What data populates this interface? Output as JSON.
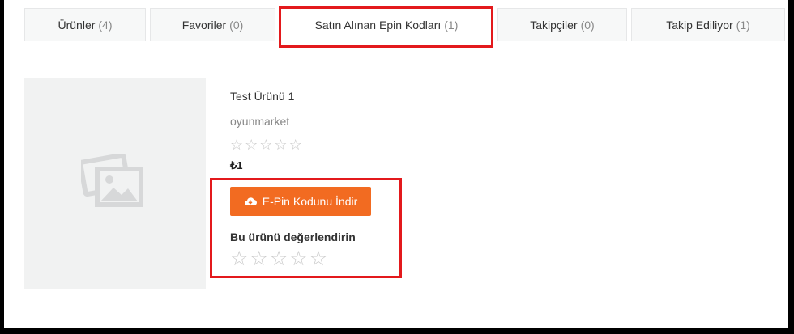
{
  "tabs": [
    {
      "label": "Ürünler",
      "count": "(4)"
    },
    {
      "label": "Favoriler",
      "count": "(0)"
    },
    {
      "label": "Satın Alınan Epin Kodları",
      "count": "(1)"
    },
    {
      "label": "Takipçiler",
      "count": "(0)"
    },
    {
      "label": "Takip Ediliyor",
      "count": "(1)"
    }
  ],
  "product": {
    "title": "Test Ürünü 1",
    "seller": "oyunmarket",
    "rating_stars": 0,
    "price": "₺1",
    "download_label": "E-Pin Kodunu İndir",
    "rate_label": "Bu ürünü değerlendirin",
    "user_rating": 0
  },
  "colors": {
    "accent": "#f26b21",
    "highlight": "#e3191c"
  },
  "icons": {
    "thumbnail": "image-placeholder-icon",
    "download": "cloud-download-icon",
    "star": "star-outline-icon"
  }
}
